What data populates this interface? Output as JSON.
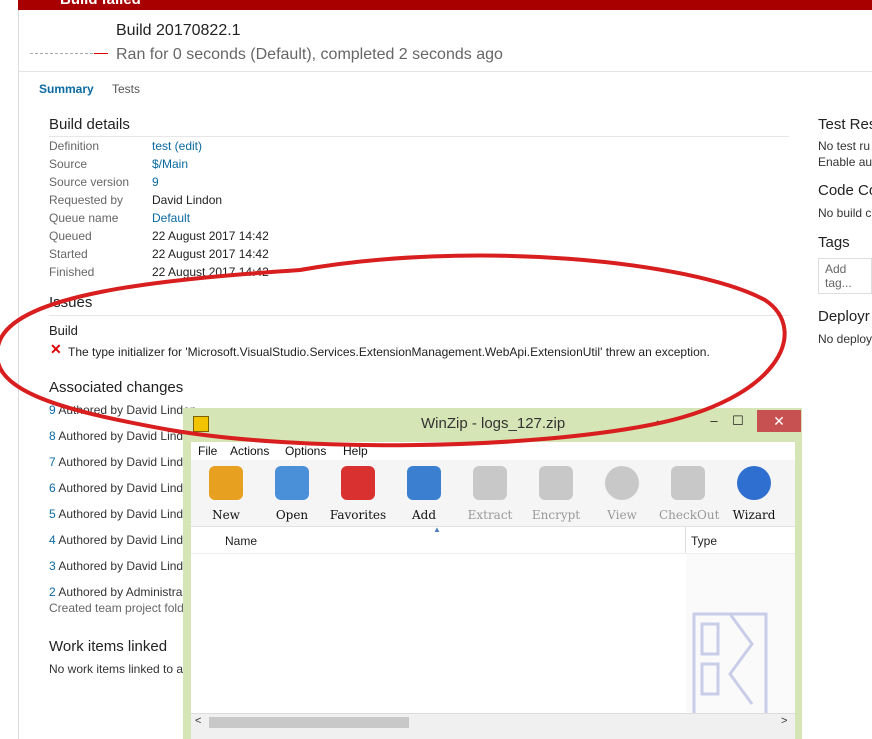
{
  "banner": {
    "text": "Build failed",
    "color": "#a80000"
  },
  "header": {
    "build_name": "Build 20170822.1",
    "run_info": "Ran for 0 seconds (Default), completed 2 seconds ago"
  },
  "tabs": [
    {
      "label": "Summary",
      "active": true
    },
    {
      "label": "Tests",
      "active": false
    }
  ],
  "build_details": {
    "title": "Build details",
    "rows": [
      {
        "label": "Definition",
        "value": "test (edit)",
        "link": true
      },
      {
        "label": "Source",
        "value": "$/Main",
        "link": true
      },
      {
        "label": "Source version",
        "value": "9",
        "link": true
      },
      {
        "label": "Requested by",
        "value": "David Lindon",
        "link": false
      },
      {
        "label": "Queue name",
        "value": "Default",
        "link": true
      },
      {
        "label": "Queued",
        "value": "22 August 2017 14:42",
        "link": false
      },
      {
        "label": "Started",
        "value": "22 August 2017 14:42",
        "link": false
      },
      {
        "label": "Finished",
        "value": "22 August 2017 14:42",
        "link": false
      }
    ]
  },
  "issues": {
    "title": "Issues",
    "group": "Build",
    "error_icon": "error-x-icon",
    "error_text": "The type initializer for 'Microsoft.VisualStudio.Services.ExtensionManagement.WebApi.ExtensionUtil' threw an exception."
  },
  "associated_changes": {
    "title": "Associated changes",
    "items": [
      {
        "num": "9",
        "text": " Authored by David Lindon"
      },
      {
        "num": "8",
        "text": " Authored by David Lind"
      },
      {
        "num": "7",
        "text": " Authored by David Lind"
      },
      {
        "num": "6",
        "text": " Authored by David Lind"
      },
      {
        "num": "5",
        "text": " Authored by David Lind"
      },
      {
        "num": "4",
        "text": " Authored by David Lind"
      },
      {
        "num": "3",
        "text": " Authored by David Lind"
      },
      {
        "num": "2",
        "text": " Authored by Administra"
      }
    ],
    "last_sub": "Created team project fold"
  },
  "work_items": {
    "title": "Work items linked",
    "text": "No work items linked to a"
  },
  "right_panel": {
    "test_results_title": "Test Res",
    "test_results_line1": "No test ru",
    "test_results_line2": "Enable aut",
    "code_coverage_title": "Code Co",
    "code_coverage_text": "No build c",
    "tags_title": "Tags",
    "add_tag": "Add tag...",
    "deploy_title": "Deployr",
    "deploy_text": "No deploy"
  },
  "winzip": {
    "title": "WinZip - logs_127.zip",
    "menu": [
      "File",
      "Actions",
      "Options",
      "Help"
    ],
    "toolbar": [
      {
        "label": "New",
        "icon": "new-icon",
        "enabled": true,
        "color": "#e8a020"
      },
      {
        "label": "Open",
        "icon": "open-folder-icon",
        "enabled": true,
        "color": "#4a90d9"
      },
      {
        "label": "Favorites",
        "icon": "favorites-icon",
        "enabled": true,
        "color": "#d93030"
      },
      {
        "label": "Add",
        "icon": "add-icon",
        "enabled": true,
        "color": "#3a7fd0"
      },
      {
        "label": "Extract",
        "icon": "extract-icon",
        "enabled": false,
        "color": "#b8b8b8"
      },
      {
        "label": "Encrypt",
        "icon": "encrypt-icon",
        "enabled": false,
        "color": "#b8b8b8"
      },
      {
        "label": "View",
        "icon": "view-icon",
        "enabled": false,
        "color": "#b8b8b8"
      },
      {
        "label": "CheckOut",
        "icon": "checkout-icon",
        "enabled": false,
        "color": "#b8b8b8"
      },
      {
        "label": "Wizard",
        "icon": "wizard-icon",
        "enabled": true,
        "color": "#2f6fd0"
      }
    ],
    "columns": [
      "Name",
      "Type"
    ],
    "accent": "#d6e5b6"
  },
  "annotation_color": "#d81e1e"
}
